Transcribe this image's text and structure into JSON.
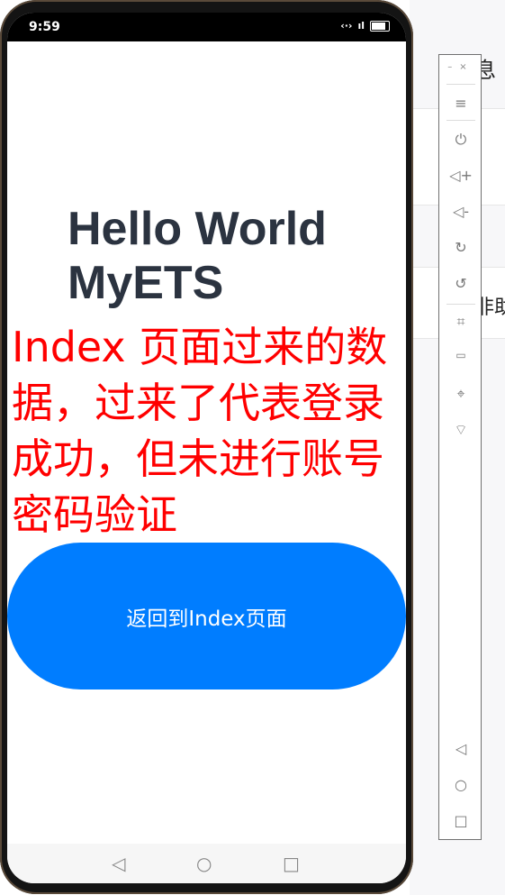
{
  "status_bar": {
    "time": "9:59"
  },
  "page": {
    "heading": "Hello World MyETS",
    "message": "Index 页面过来的数据，过来了代表登录成功，但未进行账号密码验证",
    "back_button_label": "返回到Index页面"
  },
  "background_app": {
    "fragment_1": "息",
    "fragment_2": "非助"
  },
  "colors": {
    "button": "#007dff",
    "message": "#ff0000",
    "heading": "#2b3340"
  },
  "toolbar": {
    "icons": [
      "minimize-icon",
      "close-icon",
      "menu-icon",
      "power-icon",
      "volume-up-icon",
      "volume-down-icon",
      "rotate-icon",
      "rotate-alt-icon",
      "crop-icon",
      "battery-icon",
      "location-icon",
      "wifi-icon",
      "back-icon",
      "home-icon",
      "recent-apps-icon"
    ]
  }
}
